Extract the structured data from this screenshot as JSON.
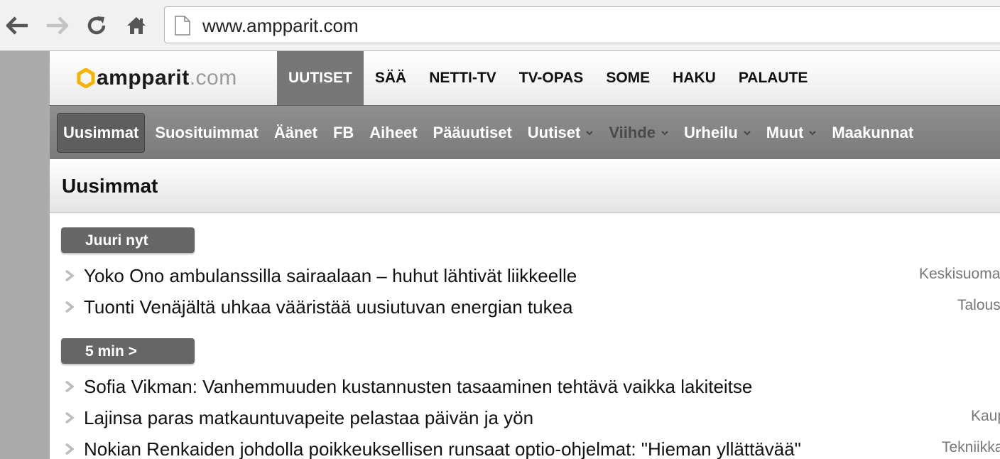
{
  "browser": {
    "url": "www.ampparit.com"
  },
  "site": {
    "logo_main": "ampparit",
    "logo_tld": ".com",
    "topnav": [
      "UUTISET",
      "SÄÄ",
      "NETTI-TV",
      "TV-OPAS",
      "SOME",
      "HAKU",
      "PALAUTE"
    ],
    "subnav": {
      "uusimmat": "Uusimmat",
      "suosituimmat": "Suosituimmat",
      "aanet": "Äänet",
      "fb": "FB",
      "aiheet": "Aiheet",
      "paauutiset": "Pääuutiset",
      "uutiset": "Uutiset",
      "viihde": "Viihde",
      "urheilu": "Urheilu",
      "muut": "Muut",
      "maakunnat": "Maakunnat"
    },
    "section_title": "Uusimmat"
  },
  "groups": [
    {
      "label": "Juuri nyt",
      "items": [
        {
          "headline": "Yoko Ono ambulanssilla sairaalaan – huhut lähtivät liikkeelle",
          "source": "Keskisuoma"
        },
        {
          "headline": "Tuonti Venäjältä uhkaa vääristää uusiutuvan energian tukea",
          "source": "Talous"
        }
      ]
    },
    {
      "label": "5 min >",
      "items": [
        {
          "headline": "Sofia Vikman: Vanhemmuuden kustannusten tasaaminen tehtävä vaikka lakiteitse",
          "source": ""
        },
        {
          "headline": "Lajinsa paras matkauntuvapeite pelastaa päivän ja yön",
          "source": "Kaup"
        },
        {
          "headline": "Nokian Renkaiden johdolla poikkeuksellisen runsaat optio-ohjelmat: \"Hieman yllättävää\"",
          "source": "Tekniikka"
        }
      ]
    }
  ]
}
